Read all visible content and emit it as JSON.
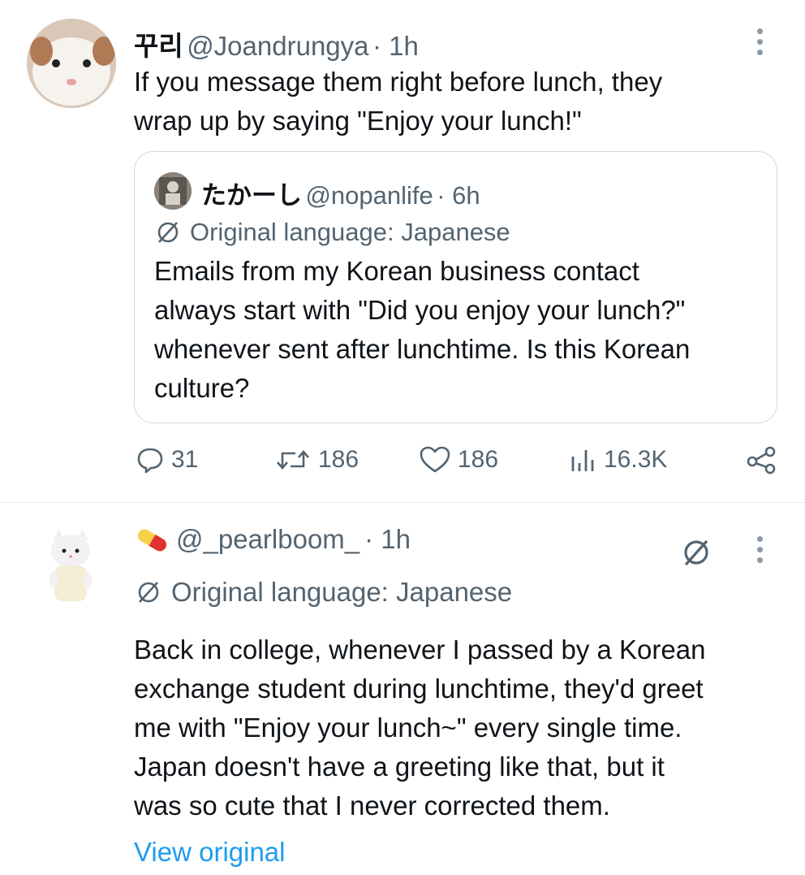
{
  "tweet1": {
    "display_name": "꾸리",
    "handle": "@Joandrungya",
    "time": "· 1h",
    "text_line1": "If you message them right before lunch, they",
    "text_line2": "wrap up by saying \"Enjoy your lunch!\""
  },
  "quoted": {
    "display_name": "たかーし",
    "handle": "@nopanlife",
    "time": "· 6h",
    "lang_note": "Original language: Japanese",
    "lines": [
      "Emails from my Korean business contact",
      "always start with \"Did you enjoy your lunch?\"",
      "whenever sent after lunchtime. Is this Korean",
      "culture?"
    ]
  },
  "actions": {
    "replies": "31",
    "reposts": "186",
    "likes": "186",
    "views": "16.3K"
  },
  "tweet2": {
    "display_emoji": "💊",
    "handle": "@_pearlboom_",
    "time": "· 1h",
    "lang_note": "Original language: Japanese",
    "lines": [
      "Back in college, whenever I passed by a Korean",
      "exchange student during lunchtime, they'd greet",
      "me with \"Enjoy your lunch~\" every single time.",
      "Japan doesn't have a greeting like that, but it",
      "was so cute that I never corrected them."
    ],
    "view_original": "View original"
  },
  "colors": {
    "secondary_text": "#536471",
    "link": "#1d9bf0",
    "border": "#cfd9de"
  },
  "icons": {
    "more": "more-dots-icon",
    "translate": "translate-icon",
    "reply": "reply-icon",
    "repost": "repost-icon",
    "like": "like-icon",
    "views": "views-icon",
    "share": "share-icon"
  }
}
